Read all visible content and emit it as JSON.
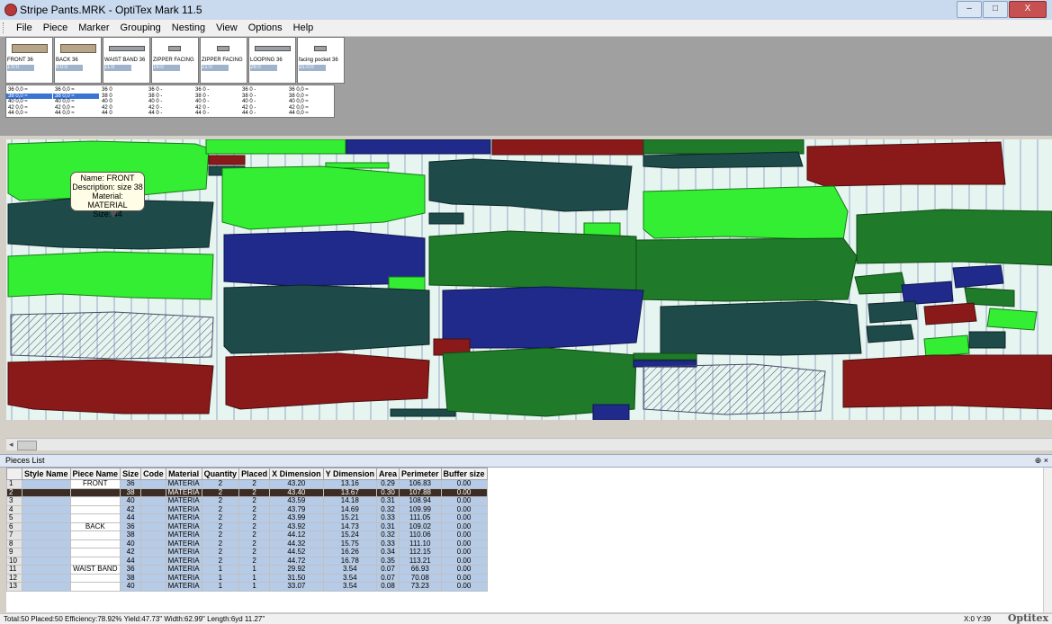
{
  "window": {
    "title": "Stripe Pants.MRK - OptiTex Mark 11.5",
    "min": "–",
    "max": "□",
    "close": "X"
  },
  "menu": [
    "File",
    "Piece",
    "Marker",
    "Grouping",
    "Nesting",
    "View",
    "Options",
    "Help"
  ],
  "tiles": [
    {
      "name": "FRONT 36",
      "code": "1:0:0"
    },
    {
      "name": "BACK 36",
      "code": "6:0:0"
    },
    {
      "name": "WAIST BAND 36",
      "code": "11:0"
    },
    {
      "name": "ZIPPER FACING",
      "code": "16:0"
    },
    {
      "name": "ZIPPER FACING",
      "code": "21:0"
    },
    {
      "name": "LOOPING 36",
      "code": "26:0"
    },
    {
      "name": "facing pocket 36",
      "code": "31:0:0"
    }
  ],
  "size_columns": [
    [
      "36 0,0 ≈",
      "38 0,0 ≈",
      "40 0,0 ≈",
      "42 0,0 ≈",
      "44 0,0 ≈"
    ],
    [
      "36 0,0 ≈",
      "38 0,0 ≈",
      "40 0,0 ≈",
      "42 0,0 ≈",
      "44 0,0 ≈"
    ],
    [
      "36 0",
      "38 0",
      "40 0",
      "42 0",
      "44 0"
    ],
    [
      "36 0 -",
      "38 0 -",
      "40 0 -",
      "42 0 -",
      "44 0 -"
    ],
    [
      "36 0 -",
      "38 0 -",
      "40 0 -",
      "42 0 -",
      "44 0 -"
    ],
    [
      "36 0 -",
      "38 0 -",
      "40 0 -",
      "42 0 -",
      "44 0 -"
    ],
    [
      "36 0,0 ≈",
      "38 0,0 ≈",
      "40 0,0 ≈",
      "42 0,0 ≈",
      "44 0,0 ≈"
    ]
  ],
  "tooltip": {
    "line1": "Name: FRONT",
    "line2": "Description: size 38",
    "line3": "Material: MATERIAL",
    "line4": "Size: 44"
  },
  "colors": {
    "bright_green": "#33ee33",
    "dark_teal": "#1e4a4a",
    "navy": "#1f2a8a",
    "maroon": "#8a1a1a",
    "mid_green": "#1f7a2a",
    "marker_bg": "#e6f5ef",
    "selected_row": "#3b2d25"
  },
  "pieces_panel": {
    "title": "Pieces List",
    "pin": "⊕ ×"
  },
  "table": {
    "columns": [
      "",
      "Style Name",
      "Piece Name",
      "Size",
      "Code",
      "Material",
      "Quantity",
      "Placed",
      "X Dimension",
      "Y Dimension",
      "Area",
      "Perimeter",
      "Buffer size"
    ],
    "rows": [
      [
        "1",
        "",
        "FRONT",
        "36",
        "",
        "MATERIA",
        "2",
        "2",
        "43.20",
        "13.16",
        "0.29",
        "106.83",
        "0.00"
      ],
      [
        "2",
        "",
        "",
        "38",
        "",
        "MATERIA",
        "2",
        "2",
        "43.40",
        "13.67",
        "0.30",
        "107.88",
        "0.00"
      ],
      [
        "3",
        "",
        "",
        "40",
        "",
        "MATERIA",
        "2",
        "2",
        "43.59",
        "14.18",
        "0.31",
        "108.94",
        "0.00"
      ],
      [
        "4",
        "",
        "",
        "42",
        "",
        "MATERIA",
        "2",
        "2",
        "43.79",
        "14.69",
        "0.32",
        "109.99",
        "0.00"
      ],
      [
        "5",
        "",
        "",
        "44",
        "",
        "MATERIA",
        "2",
        "2",
        "43.99",
        "15.21",
        "0.33",
        "111.05",
        "0.00"
      ],
      [
        "6",
        "",
        "BACK",
        "36",
        "",
        "MATERIA",
        "2",
        "2",
        "43.92",
        "14.73",
        "0.31",
        "109.02",
        "0.00"
      ],
      [
        "7",
        "",
        "",
        "38",
        "",
        "MATERIA",
        "2",
        "2",
        "44.12",
        "15.24",
        "0.32",
        "110.06",
        "0.00"
      ],
      [
        "8",
        "",
        "",
        "40",
        "",
        "MATERIA",
        "2",
        "2",
        "44.32",
        "15.75",
        "0.33",
        "111.10",
        "0.00"
      ],
      [
        "9",
        "",
        "",
        "42",
        "",
        "MATERIA",
        "2",
        "2",
        "44.52",
        "16.26",
        "0.34",
        "112.15",
        "0.00"
      ],
      [
        "10",
        "",
        "",
        "44",
        "",
        "MATERIA",
        "2",
        "2",
        "44.72",
        "16.78",
        "0.35",
        "113.21",
        "0.00"
      ],
      [
        "11",
        "",
        "WAIST BAND",
        "36",
        "",
        "MATERIA",
        "1",
        "1",
        "29.92",
        "3.54",
        "0.07",
        "66.93",
        "0.00"
      ],
      [
        "12",
        "",
        "",
        "38",
        "",
        "MATERIA",
        "1",
        "1",
        "31.50",
        "3.54",
        "0.07",
        "70.08",
        "0.00"
      ],
      [
        "13",
        "",
        "",
        "40",
        "",
        "MATERIA",
        "1",
        "1",
        "33.07",
        "3.54",
        "0.08",
        "73.23",
        "0.00"
      ]
    ],
    "selected_row": 1
  },
  "status": {
    "summary": "Total:50  Placed:50  Efficiency:78.92%  Yield:47.73\"  Width:62.99\"  Length:6yd 11.27\"",
    "coords": "X:0   Y:39",
    "logo": "Optitex"
  }
}
